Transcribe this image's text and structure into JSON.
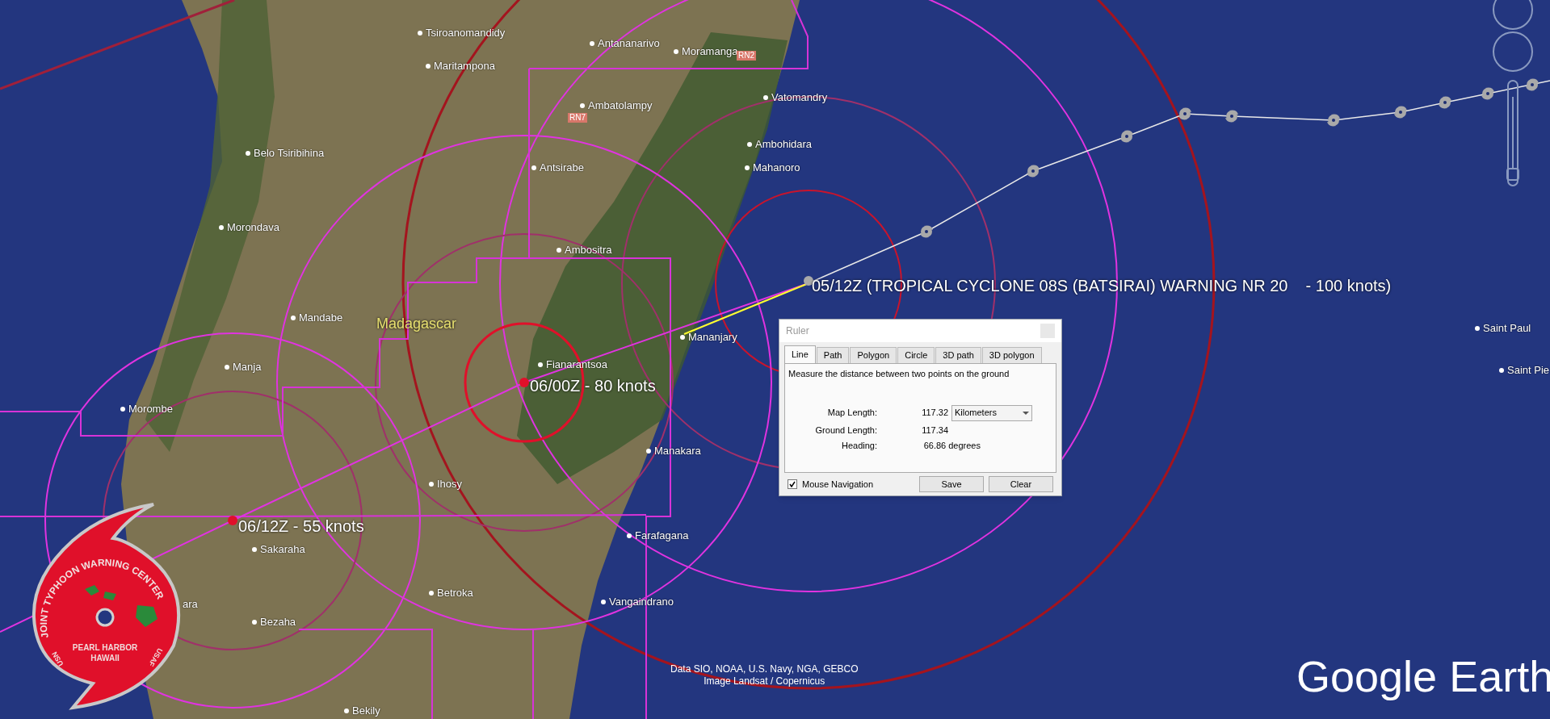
{
  "places": [
    {
      "name": "Tsiroanomandidy"
    },
    {
      "name": "Antananarivo"
    },
    {
      "name": "Moramanga"
    },
    {
      "name": "Maritampona"
    },
    {
      "name": "Ambatolampy"
    },
    {
      "name": "Vatomandry"
    },
    {
      "name": "Belo Tsiribihina"
    },
    {
      "name": "Ambohidara"
    },
    {
      "name": "Antsirabe"
    },
    {
      "name": "Mahanoro"
    },
    {
      "name": "Morondava"
    },
    {
      "name": "Ambositra"
    },
    {
      "name": "Mandabe"
    },
    {
      "name": "Mananjary"
    },
    {
      "name": "Fianarantsoa"
    },
    {
      "name": "Manja"
    },
    {
      "name": "Morombe"
    },
    {
      "name": "Manakara"
    },
    {
      "name": "Ihosy"
    },
    {
      "name": "Farafagana"
    },
    {
      "name": "Sakaraha"
    },
    {
      "name": "Betroka"
    },
    {
      "name": "Vangaindrano"
    },
    {
      "name": "ara"
    },
    {
      "name": "Bezaha"
    },
    {
      "name": "Bekily"
    },
    {
      "name": "Saint Paul"
    },
    {
      "name": "Saint Pie"
    }
  ],
  "region_label": "Madagascar",
  "road_labels": [
    "RN2",
    "RN7"
  ],
  "forecast_labels": [
    "05/12Z (TROPICAL CYCLONE 08S (BATSIRAI) WARNING NR 20    - 100 knots)",
    "06/00Z - 80 knots",
    "06/12Z - 55 knots"
  ],
  "attribution": [
    "Data SIO, NOAA, U.S. Navy, NGA, GEBCO",
    "Image Landsat / Copernicus"
  ],
  "logo": {
    "ring_text": "JOINT TYPHOON WARNING CENTER",
    "center_lines": [
      "PEARL HARBOR",
      "HAWAII"
    ],
    "left_text": "USN",
    "right_text": "USAF"
  },
  "brand": "Google Earth",
  "zoom_slider": {
    "level": 0.1
  },
  "ruler": {
    "title": "Ruler",
    "tabs": [
      {
        "label": "Line",
        "selected": true
      },
      {
        "label": "Path",
        "selected": false
      },
      {
        "label": "Polygon",
        "selected": false
      },
      {
        "label": "Circle",
        "selected": false
      },
      {
        "label": "3D path",
        "selected": false
      },
      {
        "label": "3D polygon",
        "selected": false
      }
    ],
    "description": "Measure the distance between two points on the ground",
    "rows": [
      {
        "label": "Map Length:",
        "value": "117.32"
      },
      {
        "label": "Ground Length:",
        "value": "117.34"
      },
      {
        "label": "Heading:",
        "value": "66.86 degrees"
      }
    ],
    "unit": "Kilometers",
    "mouse_navigation": {
      "label": "Mouse Navigation",
      "checked": true
    },
    "buttons": [
      "Save",
      "Clear"
    ]
  }
}
